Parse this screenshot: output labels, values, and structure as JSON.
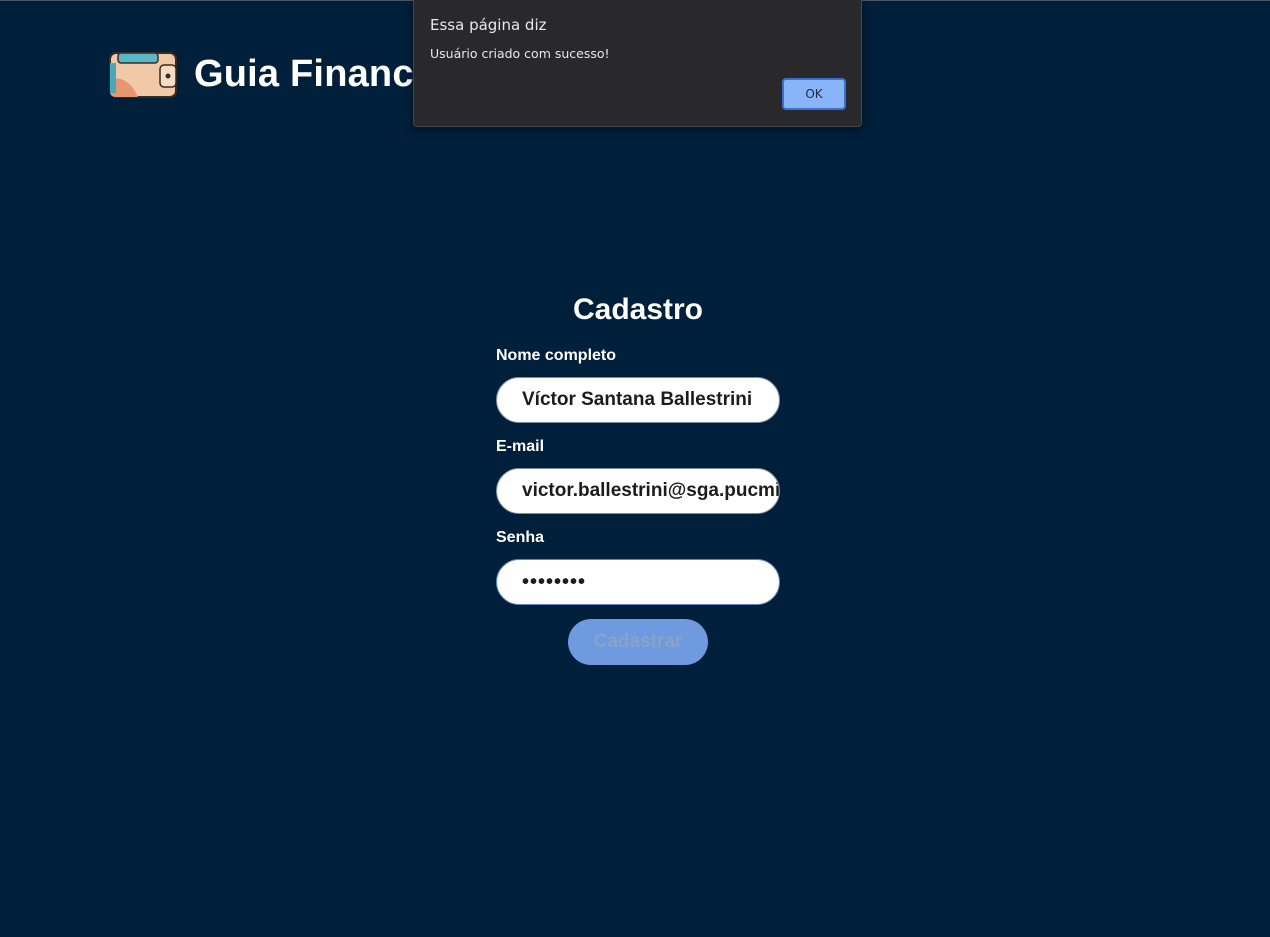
{
  "header": {
    "logo_icon": "wallet-icon",
    "title": "Guia Financeiro"
  },
  "form": {
    "title": "Cadastro",
    "name_label": "Nome completo",
    "name_value": "Víctor Santana Ballestrini",
    "email_label": "E-mail",
    "email_value": "victor.ballestrini@sga.pucminas.br",
    "password_label": "Senha",
    "password_value": "••••••••",
    "submit_label": "Cadastrar"
  },
  "dialog": {
    "title": "Essa página diz",
    "message": "Usuário criado com sucesso!",
    "ok_label": "OK"
  },
  "colors": {
    "background": "#001f3a",
    "button": "#6f9ae0",
    "dialog_bg": "#29292b",
    "ok_button": "#8ab4f8"
  }
}
